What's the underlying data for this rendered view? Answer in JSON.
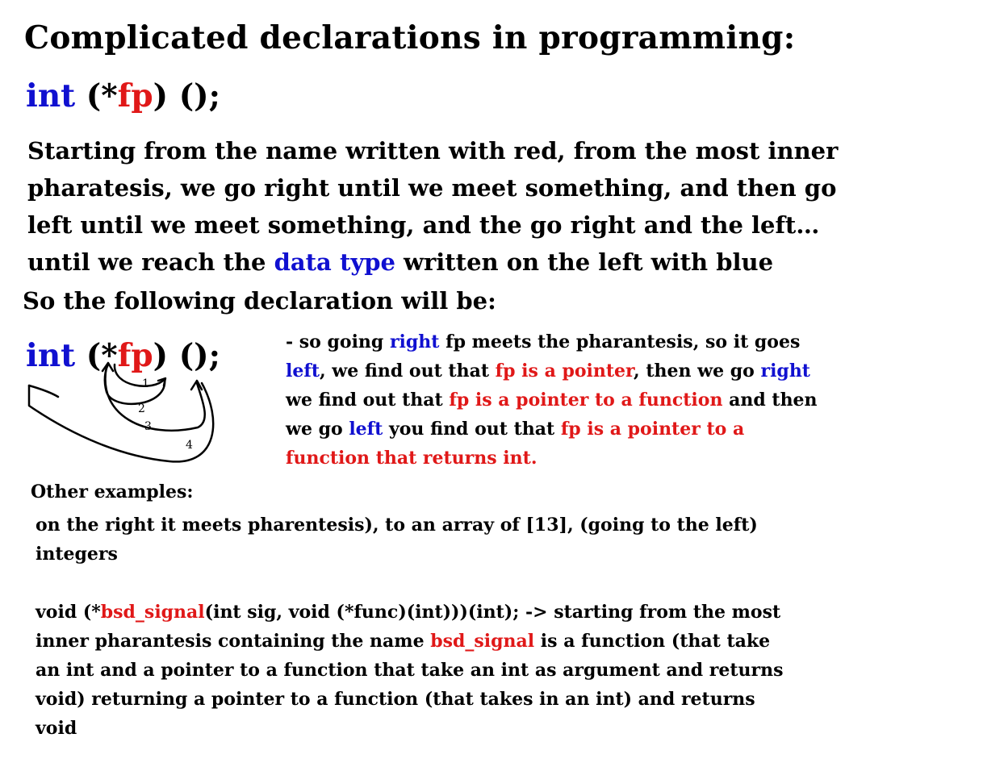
{
  "title": "Complicated declarations in programming:",
  "decl1": {
    "type": "int",
    "pre": " (*",
    "name": "fp",
    "post": ") ();"
  },
  "intro": {
    "line1": "Starting from the name written with red, from the most inner",
    "line2": "pharatesis, we go right until we meet something, and then go",
    "line3": "left until we meet something, and the go right and the left…",
    "line4_pre": "until we reach the ",
    "line4_highlight": "data type",
    "line4_post": " written on the left with blue"
  },
  "so_following": "So the following declaration will be:",
  "decl2": {
    "type": "int",
    "pre": " (*",
    "name": "fp",
    "post": ") ();",
    "step_labels": [
      "1",
      "2",
      "3",
      "4"
    ]
  },
  "explanation": {
    "l1_a": "- so going ",
    "l1_b": "right",
    "l1_c": " fp meets the pharantesis, so it goes",
    "l2_a": "left",
    "l2_b": ", we find out that ",
    "l2_c": "fp is a pointer",
    "l2_d": ", then we go ",
    "l2_e": "right",
    "l3_a": "we find out that ",
    "l3_b": "fp is a pointer to a function",
    "l3_c": " and then",
    "l4_a": "we go ",
    "l4_b": "left",
    "l4_c": " you find out that ",
    "l4_d": "fp is a pointer to a",
    "l5": "function that returns int."
  },
  "others": {
    "heading": "Other examples:",
    "ex1_l1": "on the right it meets pharentesis), to an array of [13], (going to the left)",
    "ex1_l2": "integers",
    "ex2_l1_a": "void (*",
    "ex2_l1_b": "bsd_signal",
    "ex2_l1_c": "(int sig, void (*func)(int)))(int); -> starting from the most",
    "ex2_l2_a": "inner pharantesis containing the name ",
    "ex2_l2_b": "bsd_signal",
    "ex2_l2_c": " is a function (that take",
    "ex2_l3": "an int and a pointer to a function that take an int as argument and returns",
    "ex2_l4": "void) returning a pointer to a function (that takes in an int) and returns",
    "ex2_l5": "void"
  }
}
